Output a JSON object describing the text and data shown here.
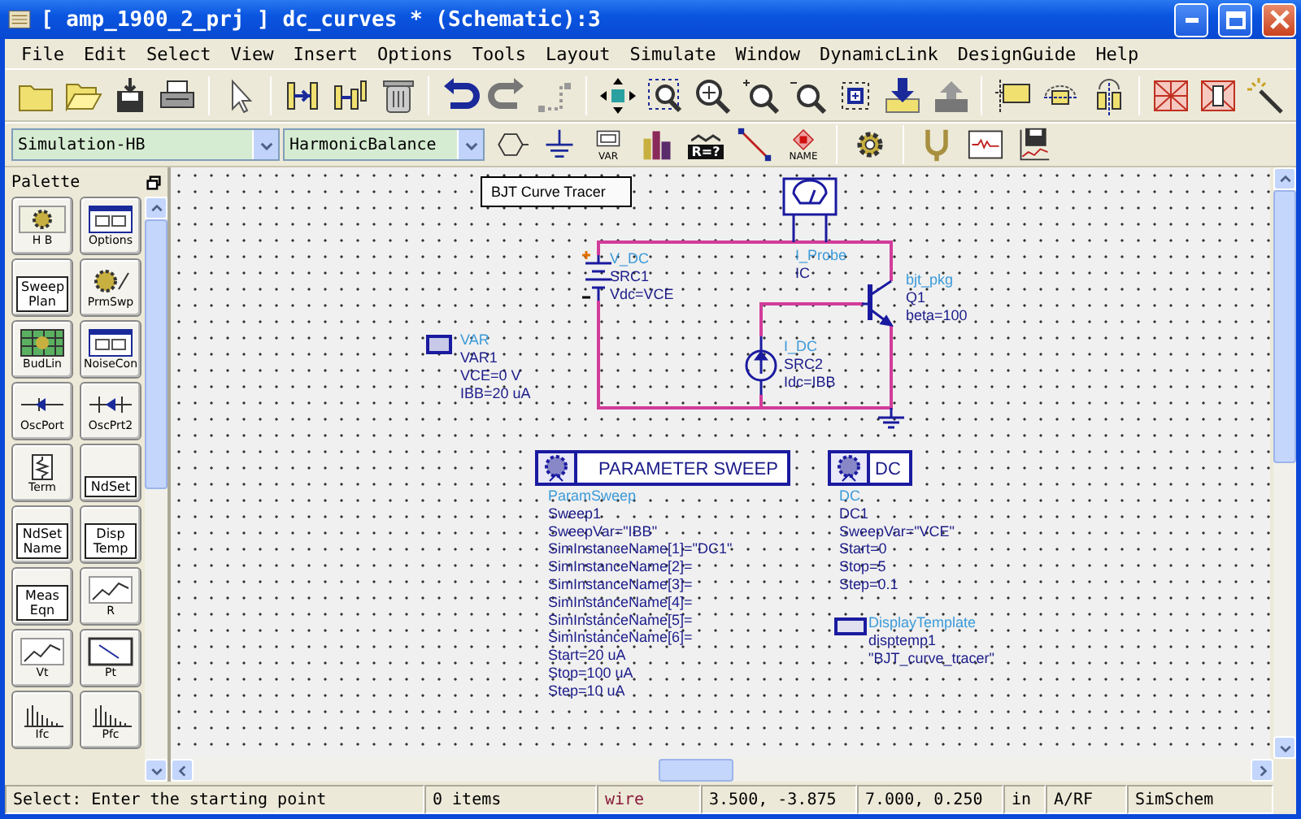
{
  "window": {
    "title": "[ amp_1900_2_prj ] dc_curves * (Schematic):3"
  },
  "menu": [
    "File",
    "Edit",
    "Select",
    "View",
    "Insert",
    "Options",
    "Tools",
    "Layout",
    "Simulate",
    "Window",
    "DynamicLink",
    "DesignGuide",
    "Help"
  ],
  "toolbar2": {
    "dropdowns": [
      {
        "value": "Simulation-HB"
      },
      {
        "value": "HarmonicBalance"
      }
    ],
    "labels": [
      "VAR",
      "R=?",
      "NAME"
    ]
  },
  "palette": {
    "title": "Palette",
    "items": [
      {
        "kind": "icon",
        "label": "H B"
      },
      {
        "kind": "icon",
        "label": "Options"
      },
      {
        "kind": "text",
        "label": "Sweep Plan"
      },
      {
        "kind": "icon",
        "label": "PrmSwp"
      },
      {
        "kind": "icon",
        "label": "BudLin"
      },
      {
        "kind": "icon",
        "label": "NoiseCon"
      },
      {
        "kind": "icon",
        "label": "OscPort"
      },
      {
        "kind": "icon",
        "label": "OscPrt2"
      },
      {
        "kind": "icon",
        "label": "Term"
      },
      {
        "kind": "text",
        "label": "NdSet"
      },
      {
        "kind": "text",
        "label": "NdSet Name"
      },
      {
        "kind": "text",
        "label": "Disp Temp"
      },
      {
        "kind": "text",
        "label": "Meas Eqn"
      },
      {
        "kind": "icon",
        "label": "R"
      },
      {
        "kind": "icon",
        "label": "Vt"
      },
      {
        "kind": "icon",
        "label": "Pt"
      },
      {
        "kind": "icon",
        "label": "Ifc"
      },
      {
        "kind": "icon",
        "label": "Pfc"
      }
    ]
  },
  "schematic": {
    "title": "BJT Curve Tracer",
    "components": [
      {
        "kind": "vsource",
        "lines": [
          "V_DC",
          "SRC1",
          "Vdc=VCE"
        ]
      },
      {
        "kind": "probe",
        "lines": [
          "I_Probe",
          "IC"
        ]
      },
      {
        "kind": "bjt",
        "lines": [
          "bjt_pkg",
          "Q1",
          "beta=100"
        ]
      },
      {
        "kind": "var",
        "lines": [
          "VAR",
          "VAR1",
          "VCE=0 V",
          "IBB=20 uA"
        ]
      },
      {
        "kind": "isource",
        "lines": [
          "I_DC",
          "SRC2",
          "Idc=IBB"
        ]
      },
      {
        "kind": "template",
        "lines": [
          "DisplayTemplate",
          "disptemp1",
          "\"BJT_curve_tracer\""
        ]
      }
    ],
    "controllers": [
      {
        "kind": "paramsweep",
        "header": "PARAMETER SWEEP",
        "lines": [
          "ParamSweep",
          "Sweep1",
          "SweepVar=\"IBB\"",
          "SimInstanceName[1]=\"DC1\"",
          "SimInstanceName[2]=",
          "SimInstanceName[3]=",
          "SimInstanceName[4]=",
          "SimInstanceName[5]=",
          "SimInstanceName[6]=",
          "Start=20 uA",
          "Stop=100 uA",
          "Step=10 uA"
        ]
      },
      {
        "kind": "dc",
        "header": "DC",
        "lines": [
          "DC",
          "DC1",
          "SweepVar=\"VCE\"",
          "Start=0",
          "Stop=5",
          "Step=0.1"
        ]
      }
    ]
  },
  "status_bar": [
    {
      "kind": "text",
      "text": "Select: Enter the starting point"
    },
    {
      "kind": "text",
      "text": "0 items"
    },
    {
      "kind": "mode",
      "text": "wire"
    },
    {
      "kind": "text",
      "text": "3.500, -3.875"
    },
    {
      "kind": "text",
      "text": "7.000, 0.250"
    },
    {
      "kind": "text",
      "text": "in"
    },
    {
      "kind": "text",
      "text": "A/RF"
    },
    {
      "kind": "text",
      "text": "SimSchem"
    }
  ]
}
